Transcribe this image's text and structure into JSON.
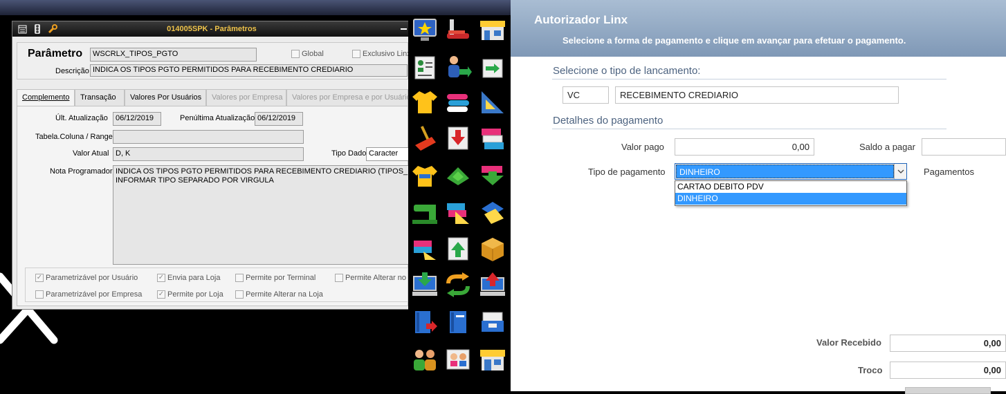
{
  "left_window": {
    "title": "014005SPK - Parâmetros",
    "toolbar_icons": [
      "grid-icon",
      "traffic-light-icon",
      "wrench-icon"
    ],
    "parametro_label": "Parâmetro",
    "parametro_value": "WSCRLX_TIPOS_PGTO",
    "global_label": "Global",
    "exclusivo_label": "Exclusivo Linx",
    "descricao_label": "Descrição",
    "descricao_value": "INDICA OS TIPOS PGTO PERMITIDOS PARA RECEBIMENTO CREDIARIO",
    "tabs": [
      {
        "label": "Complemento",
        "state": "active"
      },
      {
        "label": "Transação",
        "state": "normal"
      },
      {
        "label": "Valores Por Usuários",
        "state": "normal"
      },
      {
        "label": "Valores por Empresa",
        "state": "disabled"
      },
      {
        "label": "Valores por Empresa e por Usuário",
        "state": "disabled"
      }
    ],
    "ult_atualizacao_label": "Últ. Atualização",
    "ult_atualizacao_value": "06/12/2019",
    "penultima_label": "Penúltima Atualização",
    "penultima_value": "06/12/2019",
    "tabela_label": "Tabela.Coluna / Range",
    "tabela_value": "",
    "valor_atual_label": "Valor Atual",
    "valor_atual_value": "D, K",
    "tipo_dado_label": "Tipo Dado",
    "tipo_dado_value": "Caracter",
    "nota_label": "Nota Programador",
    "nota_line1": "INDICA OS TIPOS PGTO PERMITIDOS PARA RECEBIMENTO CREDIARIO (TIPOS_PGTO),",
    "nota_line2": "INFORMAR TIPO SEPARADO POR VIRGULA",
    "flags": [
      {
        "label": "Parametrizável por Usuário",
        "checked": true
      },
      {
        "label": "Envia para Loja",
        "checked": true
      },
      {
        "label": "Permite por Terminal",
        "checked": false
      },
      {
        "label": "Permite Alterar no T",
        "checked": false
      },
      {
        "label": "Parametrizável por Empresa",
        "checked": false
      },
      {
        "label": "Permite por Loja",
        "checked": true
      },
      {
        "label": "Permite Alterar na Loja",
        "checked": false
      }
    ]
  },
  "icon_column": {
    "icons": [
      "monitor-star-icon",
      "stapler-icon",
      "store-icon",
      "id-card-icon",
      "person-arrow-icon",
      "drawer-arrow-icon",
      "shirt-icon",
      "fabric-rolls-icon",
      "triangle-ruler-icon",
      "paint-brush-icon",
      "inbox-arrow-icon",
      "cards-icon",
      "shirt-stack-icon",
      "green-shapes-icon",
      "green-arrow-box-icon",
      "sewing-machine-icon",
      "fabric-ruler-icon",
      "blueprint-icon",
      "fabric-pencil-icon",
      "document-up-icon",
      "box-icon",
      "computer-down-icon",
      "refresh-arrows-icon",
      "computer-up-icon",
      "book-arrow-icon",
      "book-icon",
      "mail-stack-icon",
      "people-icon",
      "photo-id-icon",
      "shop-front-icon"
    ]
  },
  "autorizador": {
    "title": "Autorizador Linx",
    "subtitle": "Selecione a forma de pagamento e clique em avançar para efetuar o pagamento.",
    "section_lancamento": "Selecione o tipo de lancamento:",
    "tipo_code": "VC",
    "tipo_desc": "RECEBIMENTO CREDIARIO",
    "section_detalhes": "Detalhes do pagamento",
    "valor_pago_label": "Valor pago",
    "valor_pago_value": "0,00",
    "saldo_label": "Saldo a pagar",
    "saldo_value": "",
    "tipo_pagamento_label": "Tipo de pagamento",
    "tipo_pagamento_selected": "DINHEIRO",
    "dropdown_options": [
      "CARTAO DEBITO PDV",
      "DINHEIRO"
    ],
    "dropdown_selected_index": 1,
    "pagamentos_label": "Pagamentos",
    "valor_recebido_label": "Valor Recebido",
    "valor_recebido_value": "0,00",
    "troco_label": "Troco",
    "troco_value": "0,00",
    "colors": {
      "header": "#8fa6c2",
      "section_text": "#4d6380",
      "selection": "#3399ff",
      "title_gold": "#f0c44b"
    }
  }
}
